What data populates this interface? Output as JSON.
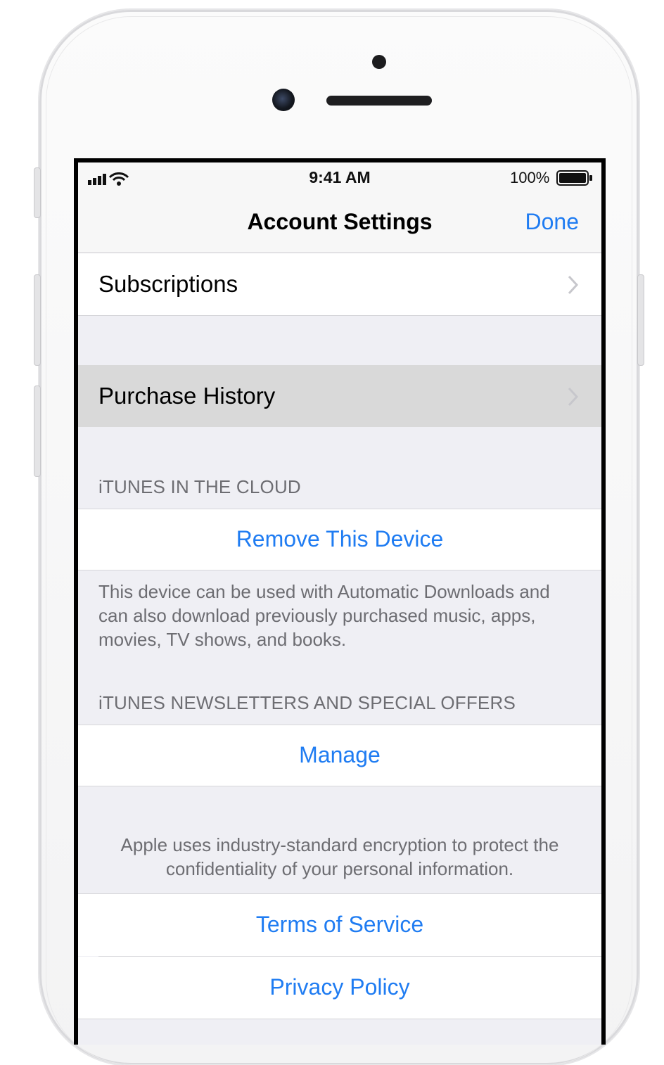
{
  "status_bar": {
    "time": "9:41 AM",
    "battery_percent": "100%",
    "signal_icon": "cellular-signal-icon",
    "wifi_icon": "wifi-icon",
    "battery_icon": "battery-full-icon"
  },
  "nav": {
    "title": "Account Settings",
    "done_label": "Done"
  },
  "rows": {
    "subscriptions": "Subscriptions",
    "purchase_history": "Purchase History"
  },
  "itunes_cloud": {
    "header": "iTUNES IN THE CLOUD",
    "remove_device": "Remove This Device",
    "footer": "This device can be used with Automatic Downloads and can also download previously purchased music, apps, movies, TV shows, and books."
  },
  "newsletters": {
    "header": "iTUNES NEWSLETTERS AND SPECIAL OFFERS",
    "manage": "Manage"
  },
  "legal": {
    "encryption_note": "Apple uses industry-standard encryption to protect the confidentiality of your personal information.",
    "terms": "Terms of Service",
    "privacy": "Privacy Policy"
  },
  "colors": {
    "accent": "#1f7cf2",
    "group_background": "#efeff4",
    "highlighted_row": "#d9d9d9",
    "secondary_text": "#6d6d72"
  }
}
